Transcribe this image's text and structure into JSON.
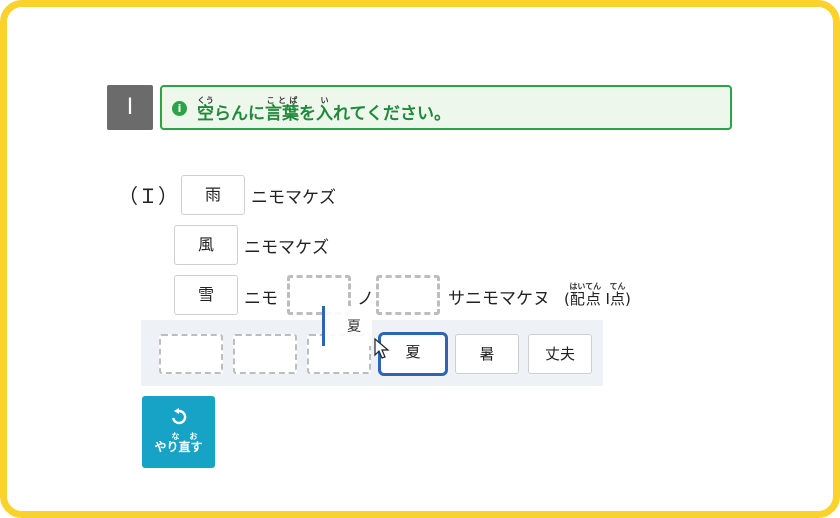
{
  "question": {
    "number": "I",
    "instruction": {
      "parts": [
        {
          "base": "空",
          "ruby": "くう"
        },
        {
          "text": "らんに"
        },
        {
          "base": "言葉",
          "ruby": "ことば"
        },
        {
          "text": "を"
        },
        {
          "base": "入",
          "ruby": "い"
        },
        {
          "text": "れてください。"
        }
      ]
    }
  },
  "problem": {
    "label": "（Ｉ）",
    "lines": [
      {
        "word": "雨",
        "suffix": "ニモマケズ"
      },
      {
        "word": "風",
        "suffix": "ニモマケズ"
      },
      {
        "word": "雪",
        "prefix_after": "ニモ",
        "mid": "ノ",
        "suffix": "サニモマケヌ"
      }
    ],
    "points": {
      "open": "(",
      "label_base": "配点",
      "label_ruby": "はいてん",
      "value": "I",
      "unit_base": "点",
      "unit_ruby": "てん",
      "close": ")"
    }
  },
  "tray": {
    "chips": [
      "夏",
      "暑",
      "丈夫"
    ],
    "selected_index": 0,
    "dragging": "夏"
  },
  "redo_button": {
    "label_base1": "や",
    "label_ruby": "なお",
    "label_base": "り直す"
  },
  "colors": {
    "frame": "#f9d22b",
    "instruction_green": "#2aa447",
    "selected_blue": "#2a66b4",
    "redo_teal": "#16a3c6"
  }
}
